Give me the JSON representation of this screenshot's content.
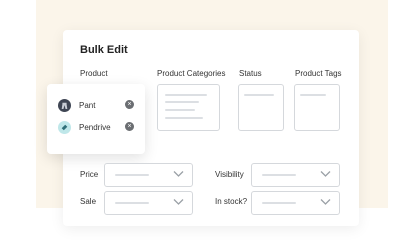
{
  "title": "Bulk Edit",
  "columns": {
    "product": "Product",
    "categories": "Product Categories",
    "status": "Status",
    "tags": "Product Tags"
  },
  "products": [
    {
      "name": "Pant",
      "icon": "pant-thumbnail-icon",
      "color": "#3f4654"
    },
    {
      "name": "Pendrive",
      "icon": "pendrive-thumbnail-icon",
      "color": "#bfe7e9"
    }
  ],
  "fields": {
    "price": "Price",
    "sale": "Sale",
    "visibility": "Visibility",
    "in_stock": "In stock?"
  },
  "colors": {
    "background_panel": "#fbf5ea",
    "border": "#d5d8dc",
    "placeholder_line": "#dcdfe3"
  }
}
